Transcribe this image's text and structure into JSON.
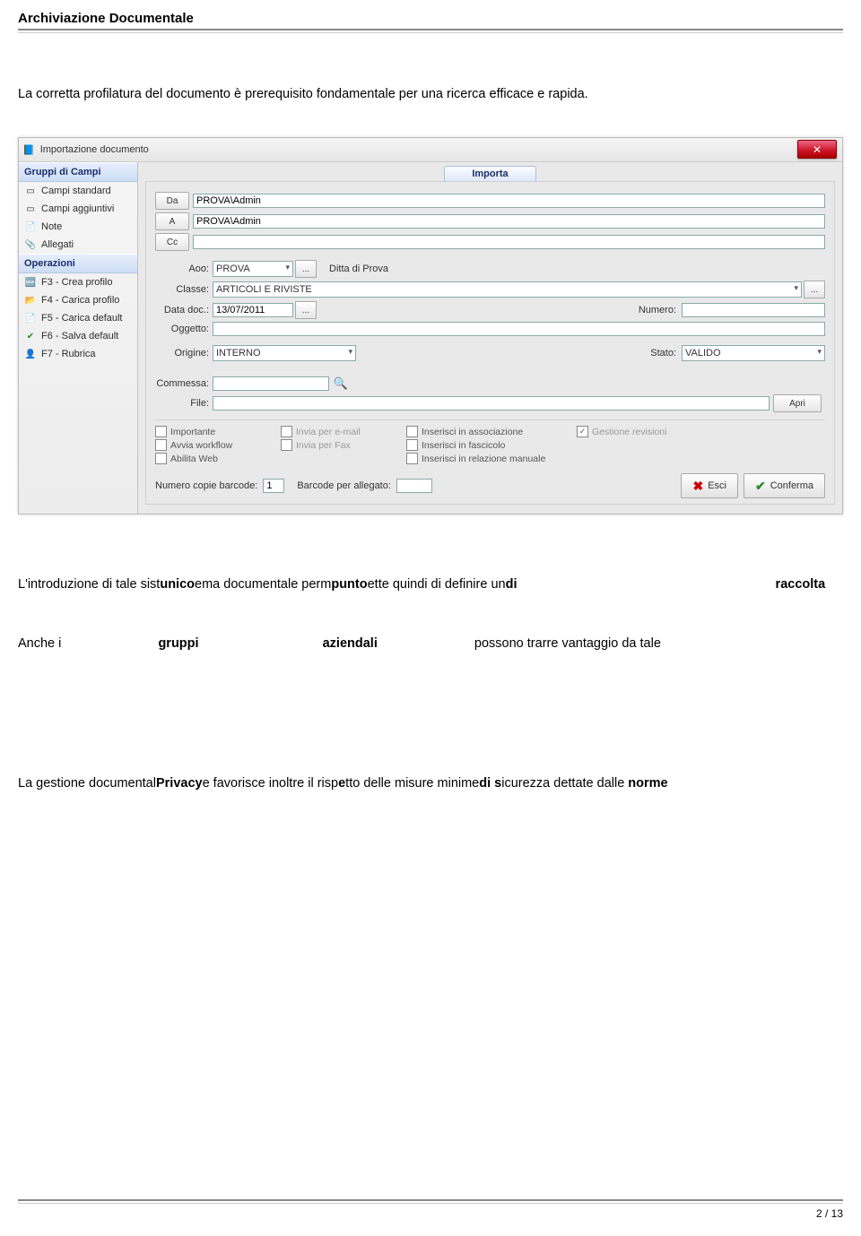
{
  "doc": {
    "header_title": "Archiviazione Documentale",
    "intro": "La corretta profilatura del documento è prerequisito fondamentale per una ricerca efficace e rapida.",
    "para_sistema_pre": "L'introduzione di tale sist",
    "para_sistema_unico": "unico",
    "para_sistema_mid1": "ema documentale perm",
    "para_sistema_punto": "punto",
    "para_sistema_mid2": "ette quindi di definire un",
    "para_sistema_di": "di",
    "para_sistema_raccolta": "raccolta",
    "para_gruppi_pre": "Anche i ",
    "para_gruppi_gruppi": "gruppi",
    "para_gruppi_aziendali": "aziendali",
    "para_gruppi_post": "possono trarre vantaggio da tale",
    "para_privacy_pre": "La gestione documental",
    "para_privacy_priv": "Privacy",
    "para_privacy_mid1": "e favorisce inoltre il risp",
    "para_privacy_e": "e",
    "para_privacy_mid2": "tto delle misure minime",
    "para_privacy_dis": "di s",
    "para_privacy_mid3": "icurezza dettate dalle",
    "para_privacy_norme": " norme",
    "page_number": "2 / 13"
  },
  "app": {
    "title": "Importazione documento",
    "sidebar": {
      "sec1_title": "Gruppi di Campi",
      "sec1_items": [
        "Campi standard",
        "Campi aggiuntivi",
        "Note",
        "Allegati"
      ],
      "sec2_title": "Operazioni",
      "sec2_items": [
        "F3 - Crea profilo",
        "F4 - Carica profilo",
        "F5 - Carica default",
        "F6 - Salva default",
        "F7 - Rubrica"
      ]
    },
    "tab": "Importa",
    "fields": {
      "da": "Da",
      "da_val": "PROVA\\Admin",
      "a": "A",
      "a_val": "PROVA\\Admin",
      "cc": "Cc",
      "cc_val": "",
      "aoo": "Aoo:",
      "aoo_val": "PROVA",
      "aoo_desc": "Ditta di Prova",
      "classe": "Classe:",
      "classe_val": "ARTICOLI E RIVISTE",
      "data": "Data doc.:",
      "data_val": "13/07/2011",
      "numero": "Numero:",
      "numero_val": "",
      "oggetto": "Oggetto:",
      "oggetto_val": "",
      "origine": "Origine:",
      "origine_val": "INTERNO",
      "stato": "Stato:",
      "stato_val": "VALIDO",
      "commessa": "Commessa:",
      "commessa_val": "",
      "file": "File:",
      "file_val": "",
      "apri": "Apri"
    },
    "checks": {
      "importante": "Importante",
      "invia_email": "Invia per e-mail",
      "ins_assoc": "Inserisci in associazione",
      "gest_rev": "Gestione revisioni",
      "avvia_wf": "Avvia workflow",
      "invia_fax": "Invia per Fax",
      "ins_fasc": "Inserisci in fascicolo",
      "abilita_web": "Abilita Web",
      "ins_rel": "Inserisci in relazione manuale"
    },
    "bottom": {
      "num_copie_lbl": "Numero copie barcode:",
      "num_copie_val": "1",
      "bcode_alleg_lbl": "Barcode per allegato:",
      "bcode_alleg_val": "",
      "esci": "Esci",
      "conferma": "Conferma"
    }
  }
}
